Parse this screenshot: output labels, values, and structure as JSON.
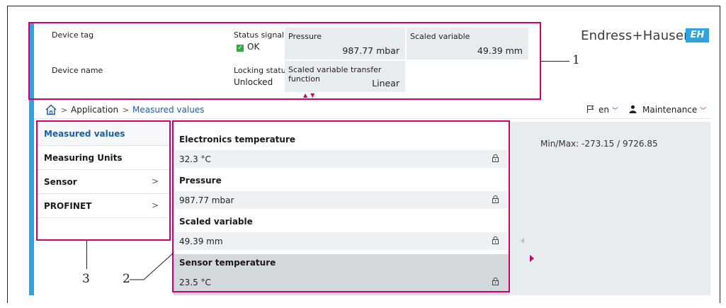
{
  "header": {
    "device_tag_label": "Device tag",
    "device_name_label": "Device name",
    "status_signal_label": "Status signal",
    "status_signal_value": "OK",
    "locking_status_label": "Locking status",
    "locking_status_value": "Unlocked",
    "boxes": [
      {
        "label": "Pressure",
        "value": "987.77 mbar"
      },
      {
        "label": "Scaled variable",
        "value": "49.39 mm"
      },
      {
        "label": "Scaled variable transfer function",
        "value": "Linear"
      }
    ]
  },
  "brand": {
    "name": "Endress+Hauser",
    "logo_text": "EH",
    "color": "#2ea3e0"
  },
  "breadcrumb": {
    "items": [
      "Application",
      "Measured values"
    ],
    "separator": ">"
  },
  "language": {
    "value": "en"
  },
  "user_role": {
    "value": "Maintenance"
  },
  "sidebar": {
    "items": [
      {
        "label": "Measured values",
        "has_submenu": false
      },
      {
        "label": "Measuring Units",
        "has_submenu": false
      },
      {
        "label": "Sensor",
        "has_submenu": true
      },
      {
        "label": "PROFINET",
        "has_submenu": true
      }
    ],
    "submenu_arrow": ">"
  },
  "params": [
    {
      "title": "Electronics temperature",
      "value": "32.3 °C"
    },
    {
      "title": "Pressure",
      "value": "987.77 mbar"
    },
    {
      "title": "Scaled variable",
      "value": "49.39 mm"
    },
    {
      "title": "Sensor temperature",
      "value": "23.5 °C"
    }
  ],
  "help_panel": {
    "text": "Min/Max: -273.15 / 9726.85"
  },
  "callouts": [
    "1",
    "2",
    "3"
  ],
  "colors": {
    "accent": "#2ea3e0",
    "highlight": "#d1006e",
    "panel": "#e7ecef",
    "ok": "#36a845",
    "active_nav": "#1a5fa8"
  }
}
